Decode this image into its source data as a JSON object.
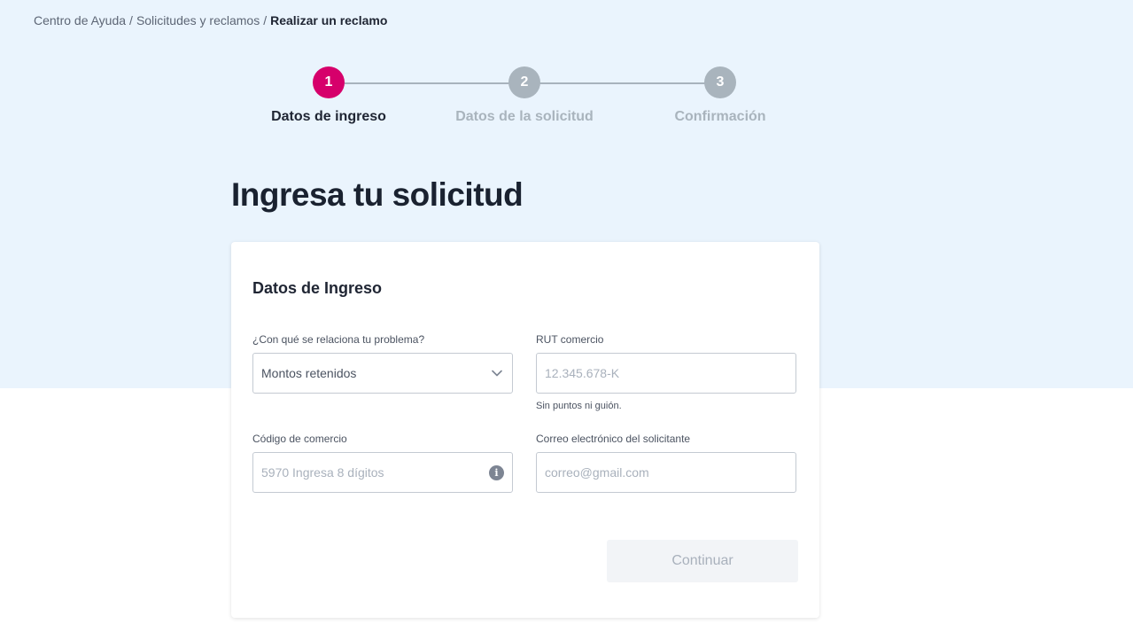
{
  "breadcrumb": {
    "items": [
      "Centro de Ayuda",
      "Solicitudes y reclamos"
    ],
    "separator": "/",
    "current": "Realizar un reclamo"
  },
  "stepper": {
    "steps": [
      {
        "number": "1",
        "label": "Datos de ingreso",
        "status": "active"
      },
      {
        "number": "2",
        "label": "Datos de la solicitud",
        "status": "pending"
      },
      {
        "number": "3",
        "label": "Confirmación",
        "status": "pending"
      }
    ],
    "active_color": "#d6006b",
    "pending_color": "#a9b4bd"
  },
  "page_title": "Ingresa tu solicitud",
  "form": {
    "title": "Datos de Ingreso",
    "problem": {
      "label": "¿Con qué se relaciona tu problema?",
      "value": "Montos retenidos",
      "icon": "chevron-down-icon"
    },
    "rut": {
      "label": "RUT comercio",
      "placeholder": "12.345.678-K",
      "hint": "Sin puntos ni guión."
    },
    "commerce_code": {
      "label": "Código de comercio",
      "placeholder": "5970 Ingresa 8 dígitos",
      "icon": "info-icon"
    },
    "email": {
      "label": "Correo electrónico del solicitante",
      "placeholder": "correo@gmail.com"
    },
    "continue_label": "Continuar"
  },
  "colors": {
    "hero_background": "#eaf4fd",
    "accent": "#d6006b",
    "disabled_button": "#f2f4f7"
  }
}
